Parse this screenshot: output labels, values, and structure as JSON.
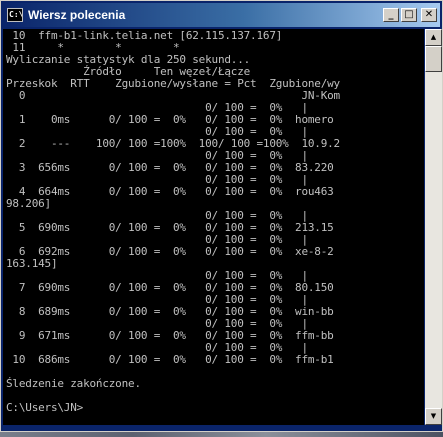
{
  "window": {
    "title": "Wiersz polecenia",
    "icon_text": "C:\\",
    "minimize_glyph": "_",
    "maximize_glyph": "□",
    "close_glyph": "✕"
  },
  "scrollbar": {
    "up_glyph": "▲",
    "down_glyph": "▼"
  },
  "console": {
    "lines": [
      " 10  ffm-b1-link.telia.net [62.115.137.167]",
      " 11     *        *        *",
      "Wyliczanie statystyk dla 250 sekund...",
      "            Źródło     Ten węzeł/Łącze",
      "Przeskok  RTT    Zgubione/wysłane = Pct  Zgubione/wy",
      "  0                                           JN-Kom",
      "                               0/ 100 =  0%   |",
      "  1    0ms      0/ 100 =  0%   0/ 100 =  0%  homero",
      "                               0/ 100 =  0%   |",
      "  2    ---    100/ 100 =100%  100/ 100 =100%  10.9.2",
      "                               0/ 100 =  0%   |",
      "  3  656ms      0/ 100 =  0%   0/ 100 =  0%  83.220",
      "                               0/ 100 =  0%   |",
      "  4  664ms      0/ 100 =  0%   0/ 100 =  0%  rou463",
      "98.206]",
      "                               0/ 100 =  0%   |",
      "  5  690ms      0/ 100 =  0%   0/ 100 =  0%  213.15",
      "                               0/ 100 =  0%   |",
      "  6  692ms      0/ 100 =  0%   0/ 100 =  0%  xe-8-2",
      "163.145]",
      "                               0/ 100 =  0%   |",
      "  7  690ms      0/ 100 =  0%   0/ 100 =  0%  80.150",
      "                               0/ 100 =  0%   |",
      "  8  689ms      0/ 100 =  0%   0/ 100 =  0%  win-bb",
      "                               0/ 100 =  0%   |",
      "  9  671ms      0/ 100 =  0%   0/ 100 =  0%  ffm-bb",
      "                               0/ 100 =  0%   |",
      " 10  686ms      0/ 100 =  0%   0/ 100 =  0%  ffm-b1",
      "",
      "Śledzenie zakończone.",
      "",
      "C:\\Users\\JN>"
    ]
  }
}
